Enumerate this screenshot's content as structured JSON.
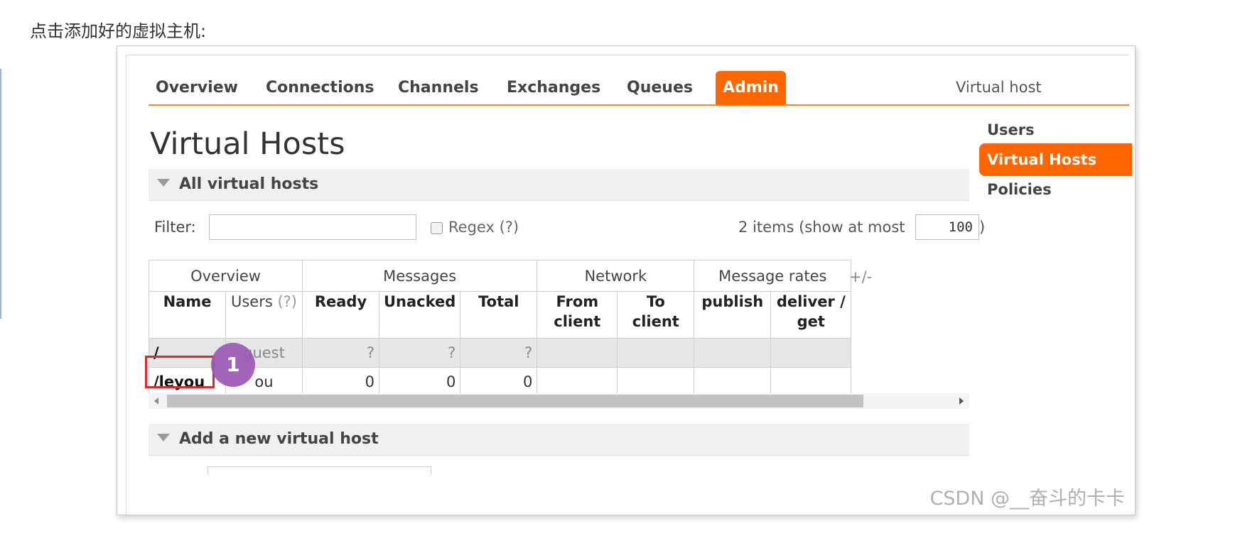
{
  "caption": "点击添加好的虚拟主机:",
  "nav": {
    "tabs": [
      {
        "label": "Overview",
        "active": false
      },
      {
        "label": "Connections",
        "active": false
      },
      {
        "label": "Channels",
        "active": false
      },
      {
        "label": "Exchanges",
        "active": false
      },
      {
        "label": "Queues",
        "active": false
      },
      {
        "label": "Admin",
        "active": true
      }
    ],
    "vhost_label": "Virtual host"
  },
  "page_title": "Virtual Hosts",
  "side_nav": [
    {
      "label": "Users",
      "active": false
    },
    {
      "label": "Virtual Hosts",
      "active": true
    },
    {
      "label": "Policies",
      "active": false
    }
  ],
  "all_section": {
    "label": "All virtual hosts"
  },
  "filter": {
    "label": "Filter:",
    "value": "",
    "regex_label": "Regex",
    "regex_help": "(?)",
    "regex_checked": false,
    "items_text": "2 items (show at most",
    "max_items": "100",
    "close_paren": ")"
  },
  "table": {
    "groups": [
      "Overview",
      "Messages",
      "Network",
      "Message rates"
    ],
    "plus_minus": "+/-",
    "columns": {
      "name": "Name",
      "users": "Users",
      "users_help": "(?)",
      "ready": "Ready",
      "unacked": "Unacked",
      "total": "Total",
      "from_client": "From client",
      "to_client": "To client",
      "publish": "publish",
      "deliver_get": "deliver / get"
    },
    "rows": [
      {
        "name": "/",
        "users": "guest",
        "ready": "?",
        "unacked": "?",
        "total": "?"
      },
      {
        "name": "/leyou",
        "users": "ou",
        "ready": "0",
        "unacked": "0",
        "total": "0"
      }
    ]
  },
  "annotation": {
    "badge": "1",
    "badge_color": "#9b59b6",
    "box_color": "#e02a2a"
  },
  "add_section": {
    "label": "Add a new virtual host"
  },
  "watermark": "CSDN @__奋斗的卡卡",
  "colors": {
    "accent": "#ff6600"
  }
}
